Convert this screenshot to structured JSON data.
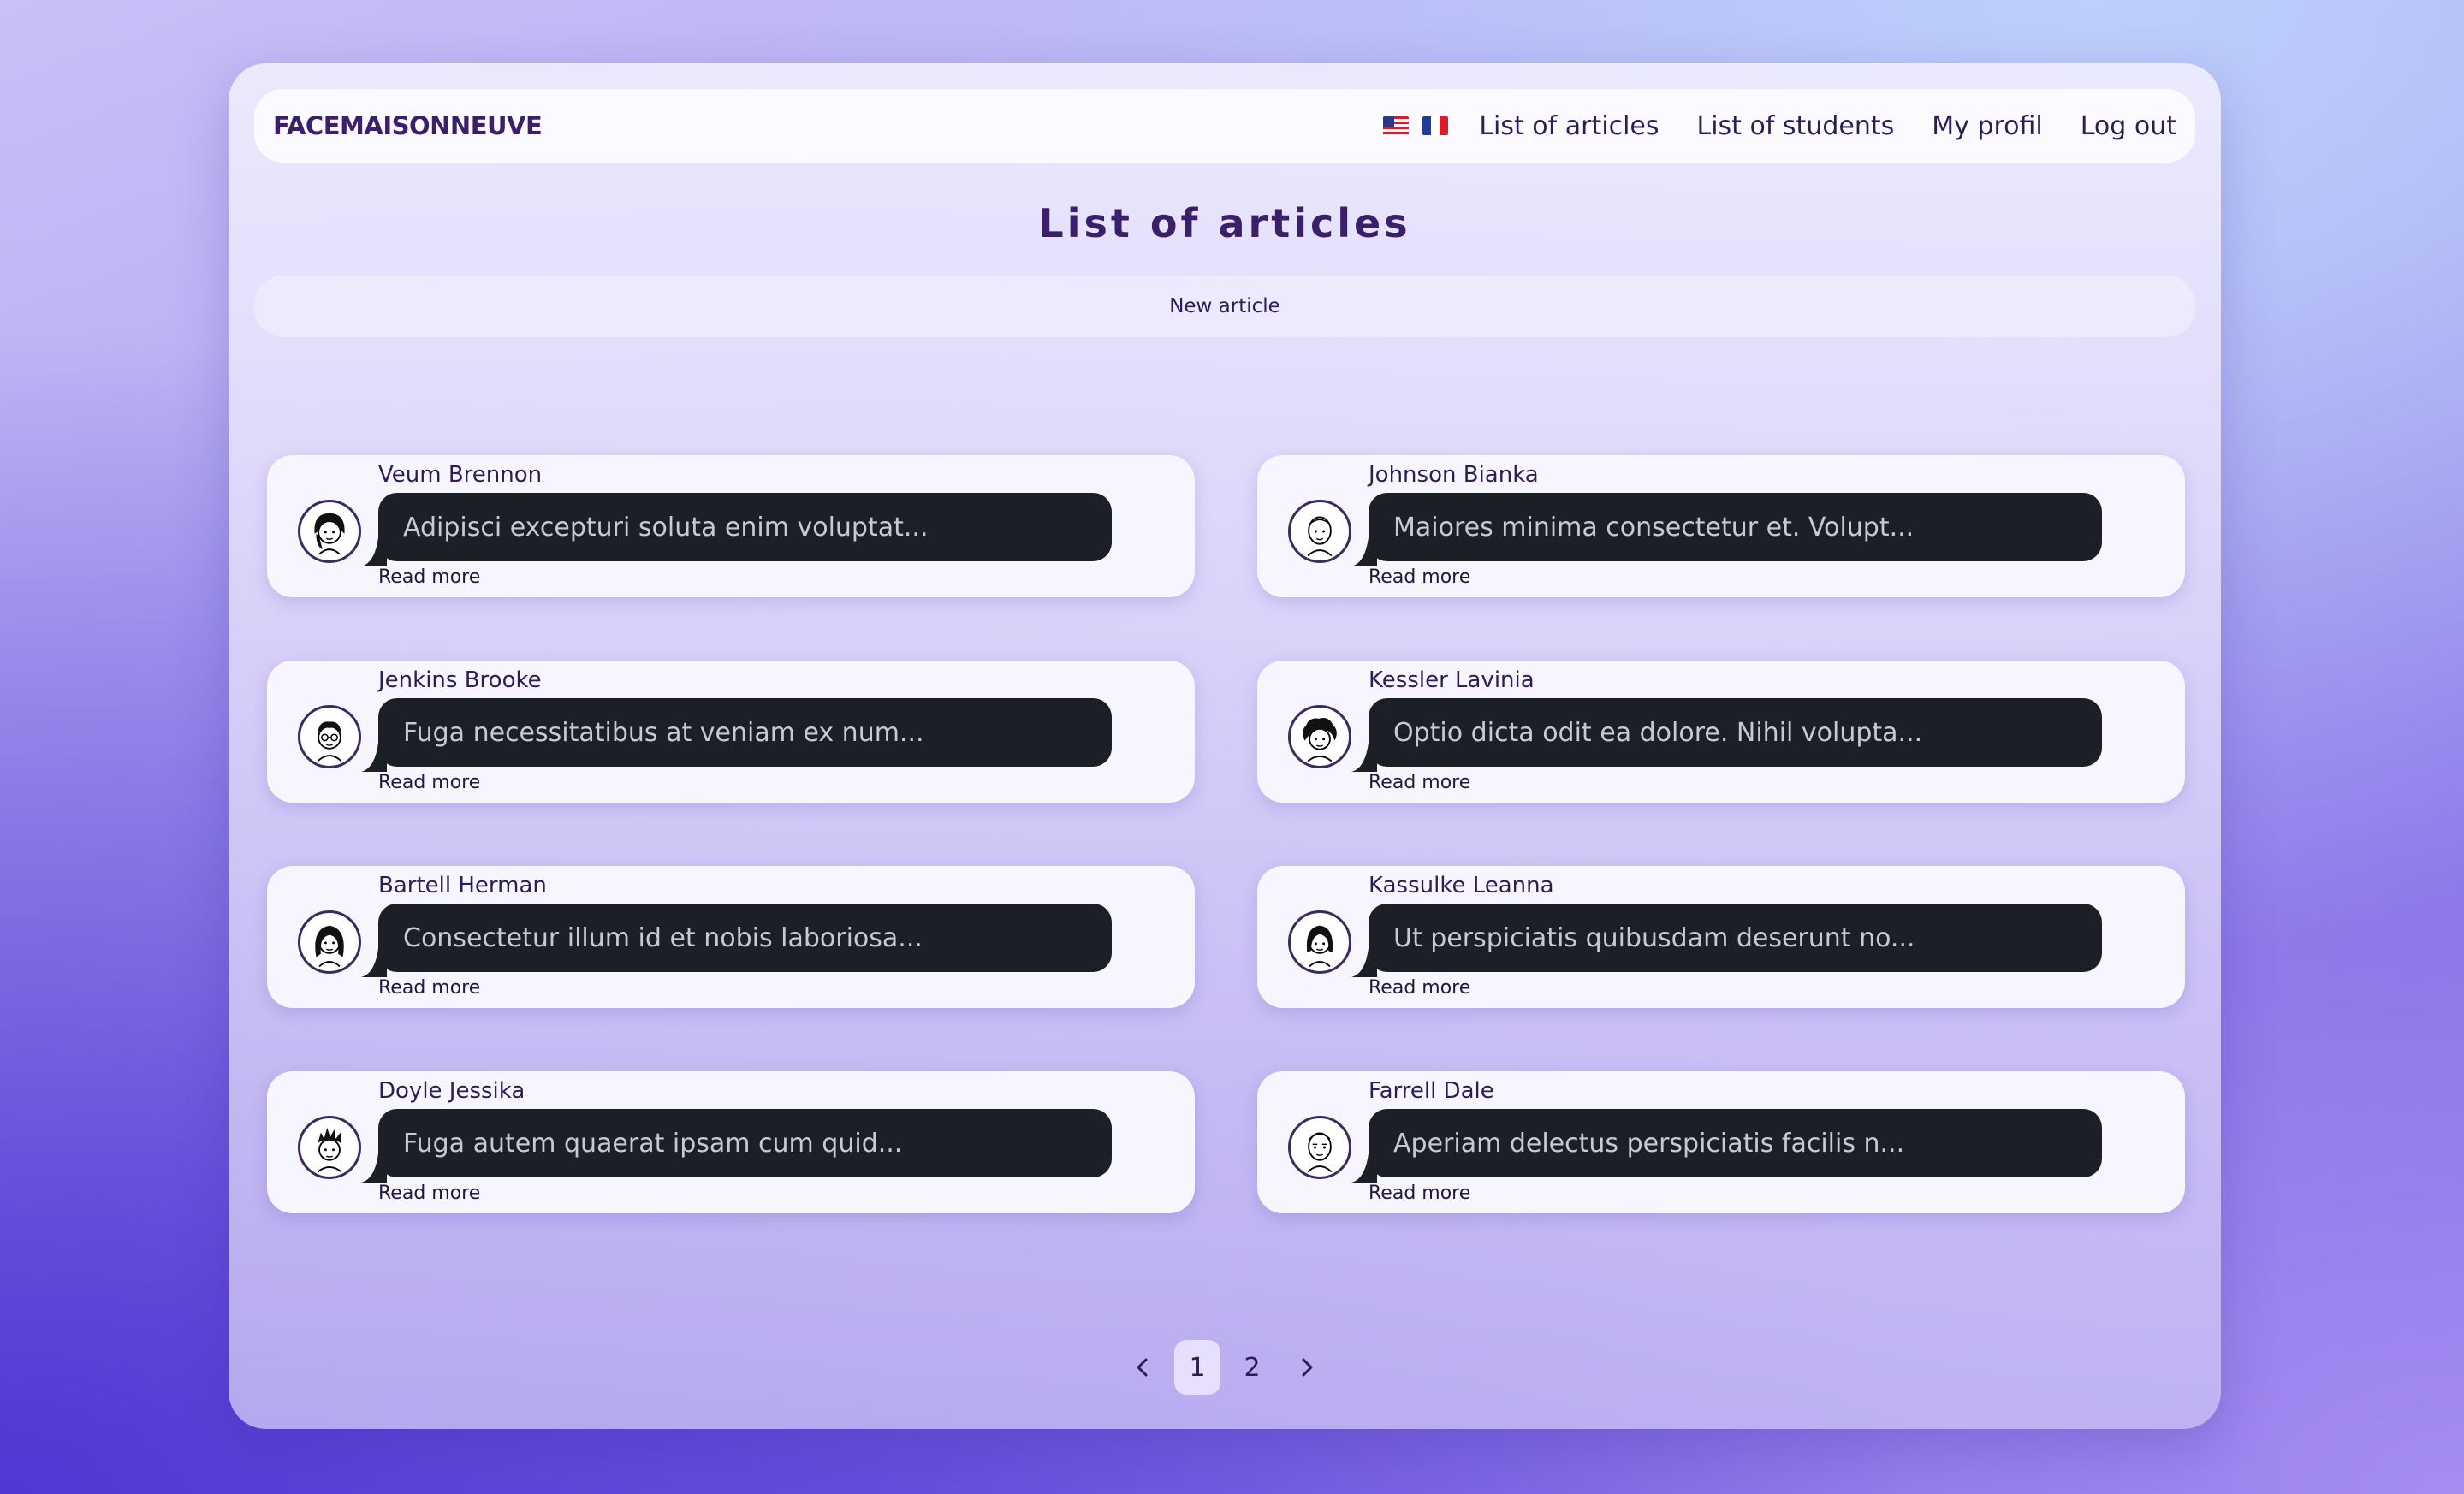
{
  "navbar": {
    "brand": "FACEMAISONNEUVE",
    "links": [
      "List of articles",
      "List of students",
      "My profil",
      "Log out"
    ]
  },
  "page": {
    "title": "List of articles",
    "new_article_label": "New article"
  },
  "articles": [
    {
      "author": "Veum Brennon",
      "excerpt": "Adipisci excepturi soluta enim voluptat...",
      "read_more": "Read more",
      "avatar_icon": "avatar-woman-long-hair-icon"
    },
    {
      "author": "Johnson Bianka",
      "excerpt": "Maiores minima consectetur et. Volupt...",
      "read_more": "Read more",
      "avatar_icon": "avatar-bald-man-icon"
    },
    {
      "author": "Jenkins Brooke",
      "excerpt": "Fuga necessitatibus at veniam ex num...",
      "read_more": "Read more",
      "avatar_icon": "avatar-glasses-man-icon"
    },
    {
      "author": "Kessler Lavinia",
      "excerpt": "Optio dicta odit ea dolore. Nihil volupta...",
      "read_more": "Read more",
      "avatar_icon": "avatar-curly-hair-icon"
    },
    {
      "author": "Bartell Herman",
      "excerpt": "Consectetur illum id et nobis laboriosa...",
      "read_more": "Read more",
      "avatar_icon": "avatar-woman-long-hair-icon"
    },
    {
      "author": "Kassulke Leanna",
      "excerpt": "Ut perspiciatis quibusdam deserunt no...",
      "read_more": "Read more",
      "avatar_icon": "avatar-woman-bob-icon"
    },
    {
      "author": "Doyle Jessika",
      "excerpt": "Fuga autem quaerat ipsam cum quid...",
      "read_more": "Read more",
      "avatar_icon": "avatar-spiky-hair-icon"
    },
    {
      "author": "Farrell Dale",
      "excerpt": "Aperiam delectus perspiciatis facilis n...",
      "read_more": "Read more",
      "avatar_icon": "avatar-bald-man-icon"
    }
  ],
  "pagination": {
    "pages": [
      "1",
      "2"
    ],
    "current": "1"
  },
  "colors": {
    "brand": "#3b1f6b",
    "bubble": "#1c1f26",
    "bubble_text": "#c9c9d2"
  }
}
